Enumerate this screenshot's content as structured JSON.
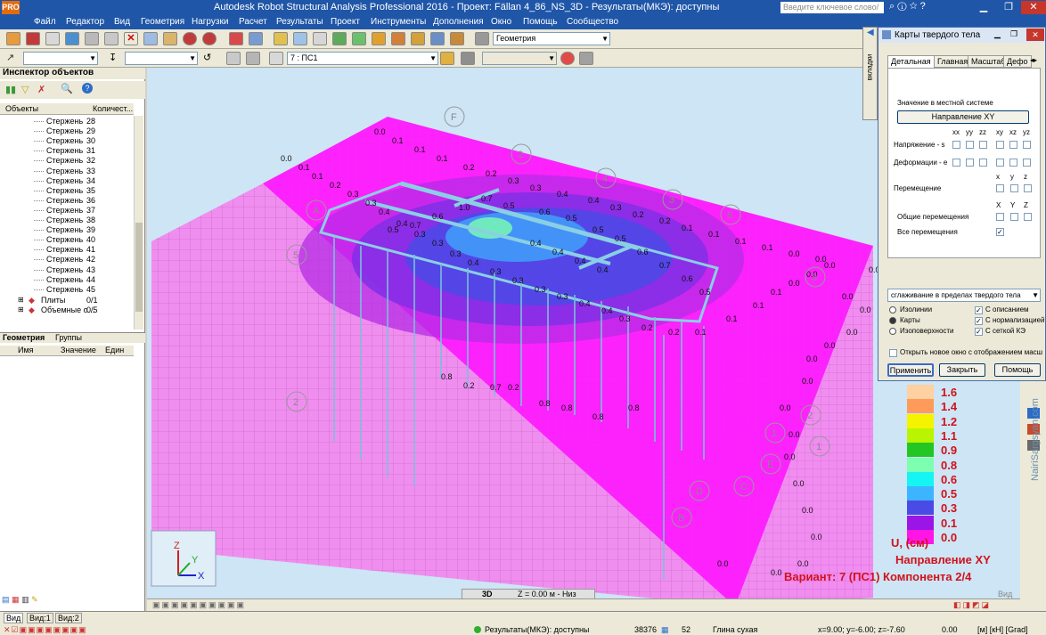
{
  "window": {
    "app_badge": "PRO",
    "title": "Autodesk Robot Structural Analysis Professional 2016 - Проект: Fällan 4_86_NS_3D - Результаты(МКЭ): доступны",
    "search_placeholder": "Введите ключевое слово/фразу"
  },
  "menu": [
    "Файл",
    "Редактор",
    "Вид",
    "Геометрия",
    "Нагрузки",
    "Расчет",
    "Результаты",
    "Проект",
    "Инструменты",
    "Дополнения",
    "Окно",
    "Помощь",
    "Сообщество"
  ],
  "toolbar": {
    "geometry_combo": "Геометрия",
    "load_case_combo": "7 : ПС1"
  },
  "inspector": {
    "title": "Инспектор объектов",
    "col_objects": "Объекты",
    "col_count": "Количест...",
    "bars": [
      {
        "label": "Стержень",
        "num": "28"
      },
      {
        "label": "Стержень",
        "num": "29"
      },
      {
        "label": "Стержень",
        "num": "30"
      },
      {
        "label": "Стержень",
        "num": "31"
      },
      {
        "label": "Стержень",
        "num": "32"
      },
      {
        "label": "Стержень",
        "num": "33"
      },
      {
        "label": "Стержень",
        "num": "34"
      },
      {
        "label": "Стержень",
        "num": "35"
      },
      {
        "label": "Стержень",
        "num": "36"
      },
      {
        "label": "Стержень",
        "num": "37"
      },
      {
        "label": "Стержень",
        "num": "38"
      },
      {
        "label": "Стержень",
        "num": "39"
      },
      {
        "label": "Стержень",
        "num": "40"
      },
      {
        "label": "Стержень",
        "num": "41"
      },
      {
        "label": "Стержень",
        "num": "42"
      },
      {
        "label": "Стержень",
        "num": "43"
      },
      {
        "label": "Стержень",
        "num": "44"
      },
      {
        "label": "Стержень",
        "num": "45"
      }
    ],
    "plates_label": "Плиты",
    "plates_count": "0/1",
    "volumes_label": "Объемные о...",
    "volumes_count": "0/5",
    "tab_geometry": "Геометрия",
    "tab_groups": "Группы",
    "prop_name": "Имя",
    "prop_value": "Значение",
    "prop_unit": "Един"
  },
  "dialog": {
    "title": "Карты твердого тела",
    "tabs": [
      "Детальная",
      "Главная",
      "Масштаб",
      "Дефо"
    ],
    "local_system_label": "Значение в местной системе",
    "direction_button": "Направление XY",
    "col_headers": [
      "xx",
      "yy",
      "zz",
      "xy",
      "xz",
      "yz"
    ],
    "stress_label": "Напряжение - s",
    "strain_label": "Деформации - e",
    "disp_label": "Перемещение",
    "xyz_headers": [
      "x",
      "y",
      "z"
    ],
    "xyz_headers_upper": [
      "X",
      "Y",
      "Z"
    ],
    "total_disp_label": "Общие перемещения",
    "all_disp_label": "Все перемещения",
    "smoothing_combo": "сглаживание в пределах твердого тела",
    "radio_isolines": "Изолинии",
    "radio_maps": "Карты",
    "radio_isosurfaces": "Изоповерхности",
    "cb_description": "С описанием",
    "cb_normalized": "С нормализацией",
    "cb_mesh": "С сеткой КЭ",
    "cb_new_window": "Открыть новое окно с отображением масштаб",
    "apply": "Применить",
    "close": "Закрыть",
    "help": "Помощь"
  },
  "side_tab": "вкладки",
  "legend": {
    "values": [
      "1.6",
      "1.4",
      "1.2",
      "1.1",
      "0.9",
      "0.8",
      "0.6",
      "0.5",
      "0.3",
      "0.1",
      "0.0"
    ],
    "colors": [
      "#ffd0a0",
      "#ff9b5a",
      "#f4f400",
      "#b9f400",
      "#23c623",
      "#7dffb0",
      "#16f4f4",
      "#3cb4ff",
      "#4a4ae6",
      "#9b16e6",
      "#ff16e6"
    ]
  },
  "results": {
    "unit_line": "U, (см)",
    "direction_line": "Направление XY",
    "variant_line": "Вариант: 7 (ПС1) Компонента 2/4"
  },
  "view": {
    "mode": "3D",
    "z_label": "Z = 0.00 м - Низ",
    "view_word": "Вид",
    "axis_x": "X",
    "axis_y": "Y",
    "axis_z": "Z"
  },
  "status": {
    "tab_view": "Вид",
    "tab_view1": "Вид:1",
    "tab_view2": "Вид:2",
    "results_status": "Результаты(МКЭ): доступны",
    "nodes": "38376",
    "elements": "52",
    "material": "Глина сухая",
    "coords": "x=9.00; y=-6.00; z=-7.60",
    "value": "0.00",
    "units": "[м] [кН] [Grad]"
  },
  "watermark": "NairiSargsyan.com",
  "contour_labels": [
    "0.0",
    "0.1",
    "0.2",
    "0.3",
    "0.4",
    "0.5",
    "0.6",
    "0.7",
    "0.8",
    "1.0"
  ],
  "grid_labels": [
    "F",
    "A",
    "B",
    "C",
    "D",
    "E",
    "1",
    "2",
    "3",
    "4",
    "5",
    "6"
  ]
}
